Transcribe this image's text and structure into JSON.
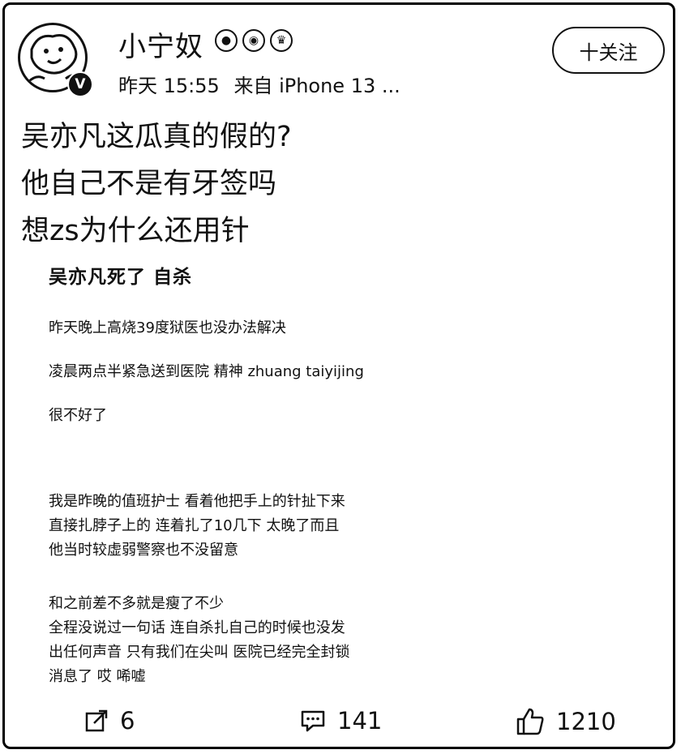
{
  "post": {
    "username": "小宁奴",
    "badges": [
      "badge-1",
      "badge-2",
      "badge-3"
    ],
    "time": "昨天 15:55",
    "source": "来自 iPhone 13 ...",
    "follow_label": "十关注",
    "verified_mark": "V",
    "text_lines": [
      "吴亦凡这瓜真的假的?",
      "他自己不是有牙签吗",
      "想zs为什么还用针"
    ]
  },
  "embedded": {
    "headline": "吴亦凡死了 自杀",
    "para1": "昨天晚上高烧39度狱医也没办法解决",
    "para2": "凌晨两点半紧急送到医院 精神 zhuang taiyijing",
    "para3": "很不好了",
    "para4": [
      "我是昨晚的值班护士 看着他把手上的针扯下来",
      "直接扎脖子上的 连着扎了10几下 太晚了而且",
      "他当时较虚弱警察也不没留意"
    ],
    "para5": [
      "和之前差不多就是瘦了不少",
      "全程没说过一句话 连自杀扎自己的时候也没发",
      "出任何声音 只有我们在尖叫 医院已经完全封锁",
      "消息了 哎 唏嘘"
    ]
  },
  "actions": {
    "repost_count": "6",
    "comment_count": "141",
    "like_count": "1210",
    "icons": {
      "repost": "share-icon",
      "comment": "comment-icon",
      "like": "thumbs-up-icon"
    }
  }
}
